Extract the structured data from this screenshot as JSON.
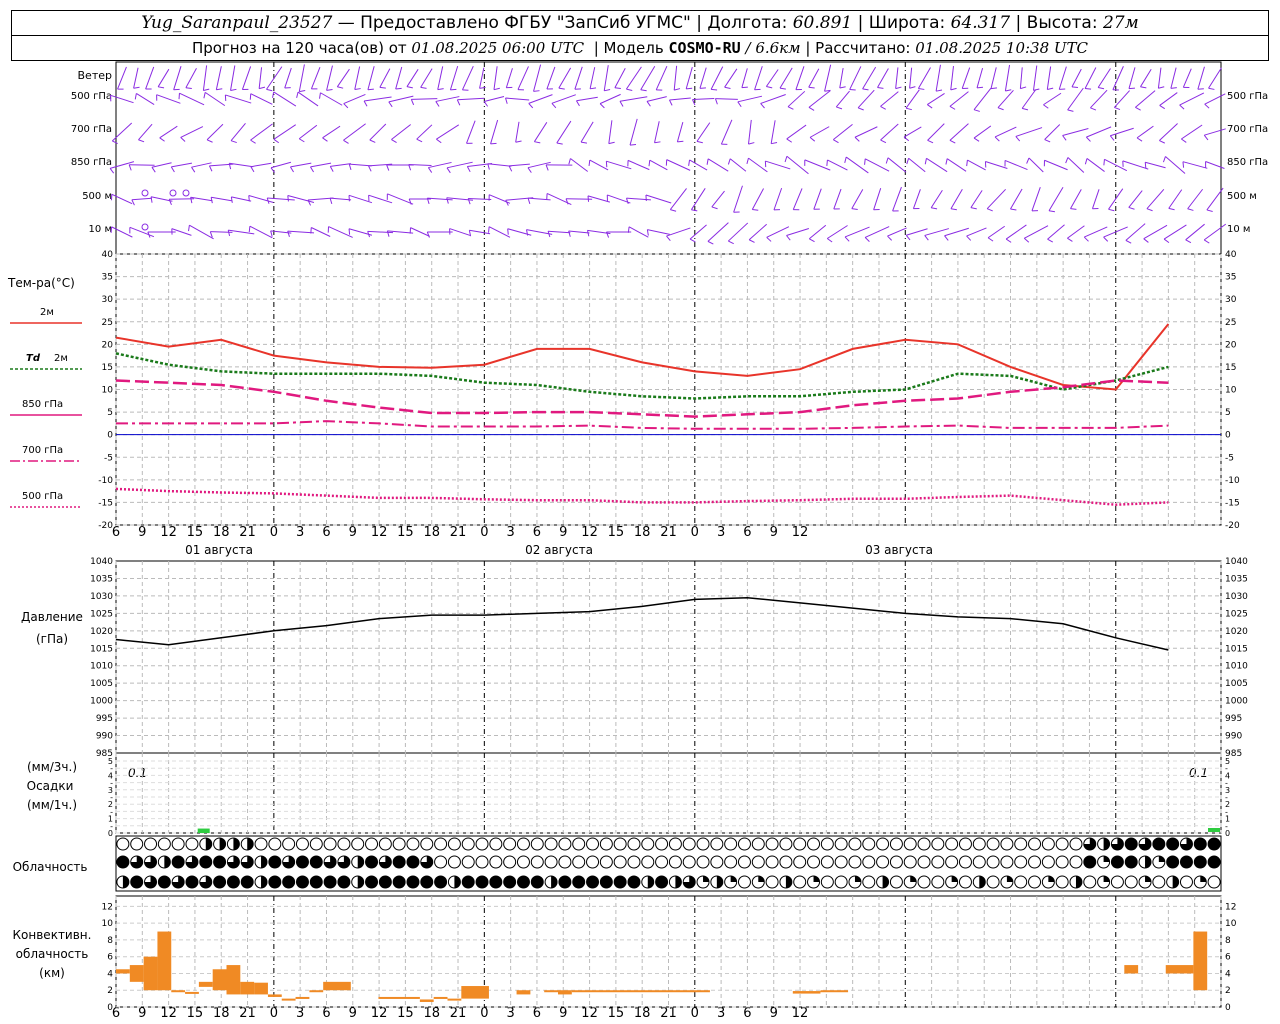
{
  "header": {
    "station": "Yug_Saranpaul_23527",
    "provider": "— Предоставлено ФГБУ \"ЗапСиб УГМС\"",
    "lon_label": "Долгота:",
    "lon": "60.891",
    "lat_label": "Широта:",
    "lat": "64.317",
    "alt_label": "Высота:",
    "alt": "27м",
    "forecast_prefix": "Прогноз на 120 часа(ов) от",
    "forecast_start": "01.08.2025 06:00 UTC",
    "model_label": "Модель",
    "model_name": "COSMO-RU",
    "model_res": "/ 6.6км",
    "calc_label": "Рассчитано:",
    "calc_time": "01.08.2025 10:38 UTC"
  },
  "labels": {
    "wind": "Ветер",
    "wind_levels": [
      "500 гПа",
      "700 гПа",
      "850 гПа",
      "500 м",
      "10  м"
    ],
    "temp": "Тем-ра(°C)",
    "t2m": "2м",
    "td": "Td",
    "td2": "2м",
    "t850": "850 гПа",
    "t700": "700 гПа",
    "t500": "500 гПа",
    "pressure": "Давление",
    "pressure_unit": "(гПа)",
    "precip_unit3": "(мм/3ч.)",
    "precip": "Осадки",
    "precip_unit1": "(мм/1ч.)",
    "precip_left_val": "0.1",
    "precip_right_val": "0.1",
    "cloud": "Облачность",
    "conv1": "Конвективн.",
    "conv2": "облачность",
    "conv3": "(км)"
  },
  "time_axis": {
    "hour_labels": [
      "6",
      "9",
      "12",
      "15",
      "18",
      "21",
      "0",
      "3",
      "6",
      "9",
      "12",
      "15",
      "18",
      "21",
      "0",
      "3",
      "6",
      "9",
      "12",
      "15",
      "18",
      "21",
      "0",
      "3",
      "6",
      "9",
      "12"
    ],
    "date_labels": [
      "01 августа",
      "02 августа",
      "03 августа"
    ]
  },
  "colors": {
    "wind": "#8a2be2",
    "t2m": "#e8342a",
    "td": "#1a7a1a",
    "t850": "#e0197f",
    "t700": "#e0197f",
    "t500": "#e0197f",
    "pressure": "#000000",
    "precip": "#2ecc40",
    "conv": "#f08a24",
    "zero_line": "#0000cc"
  },
  "chart_data": [
    {
      "type": "line",
      "title": "Тем-ра(°C)",
      "x_unit": "hours from 01.08.2025 06:00 UTC",
      "ylim": [
        -20,
        40
      ],
      "yticks": [
        -20,
        -15,
        -10,
        -5,
        0,
        5,
        10,
        15,
        20,
        25,
        30,
        35,
        40
      ],
      "grid": true,
      "x": [
        0,
        6,
        12,
        18,
        24,
        30,
        36,
        42,
        48,
        54,
        60,
        66,
        72,
        78,
        84,
        90,
        96,
        102,
        108,
        114,
        120
      ],
      "series": [
        {
          "name": "2м",
          "values": [
            21.5,
            19.5,
            21,
            17.5,
            16,
            15,
            14.8,
            15.5,
            19,
            19,
            16,
            14,
            13,
            14.5,
            19,
            21,
            20,
            15,
            11,
            10,
            24.5
          ]
        },
        {
          "name": "Td 2м",
          "values": [
            18,
            15.5,
            14,
            13.5,
            13.5,
            13.5,
            13,
            11.5,
            11,
            9.5,
            8.5,
            8,
            8.5,
            8.5,
            9.5,
            10,
            13.5,
            13,
            10,
            12,
            15
          ]
        },
        {
          "name": "850 гПа",
          "values": [
            12,
            11.5,
            11,
            9.5,
            7.5,
            6,
            4.8,
            4.8,
            5,
            5,
            4.5,
            4,
            4.5,
            5,
            6.5,
            7.5,
            8,
            9.5,
            10.5,
            12,
            11.5
          ]
        },
        {
          "name": "700 гПа",
          "values": [
            2.5,
            2.5,
            2.5,
            2.5,
            3,
            2.5,
            1.8,
            1.8,
            1.8,
            2,
            1.5,
            1.3,
            1.3,
            1.3,
            1.5,
            1.8,
            2,
            1.5,
            1.5,
            1.5,
            2
          ]
        },
        {
          "name": "500 гПа",
          "values": [
            -12,
            -12.5,
            -12.8,
            -13,
            -13.5,
            -14,
            -14,
            -14.3,
            -14.5,
            -14.5,
            -15,
            -15,
            -14.7,
            -14.5,
            -14.2,
            -14.2,
            -13.8,
            -13.5,
            -14.5,
            -15.5,
            -15
          ]
        }
      ]
    },
    {
      "type": "line",
      "title": "Давление (гПа)",
      "x_unit": "hours from 01.08.2025 06:00 UTC",
      "ylim": [
        985,
        1040
      ],
      "yticks": [
        985,
        990,
        995,
        1000,
        1005,
        1010,
        1015,
        1020,
        1025,
        1030,
        1035,
        1040
      ],
      "grid": true,
      "x": [
        0,
        6,
        12,
        18,
        24,
        30,
        36,
        42,
        48,
        54,
        60,
        66,
        72,
        78,
        84,
        90,
        96,
        102,
        108,
        114,
        120
      ],
      "series": [
        {
          "name": "Давление",
          "values": [
            1017.5,
            1016,
            1018,
            1020,
            1021.5,
            1023.5,
            1024.5,
            1024.5,
            1025,
            1025.5,
            1027,
            1029,
            1029.5,
            1028,
            1026.5,
            1025,
            1024,
            1023.5,
            1022,
            1018,
            1014.5
          ]
        }
      ]
    },
    {
      "type": "bar",
      "title": "Осадки",
      "ylim": [
        0,
        5
      ],
      "x": [
        10
      ],
      "values": [
        0.1
      ]
    },
    {
      "type": "bar",
      "title": "Конвективн. облачность (км)",
      "ylim": [
        0,
        13
      ],
      "yticks": [
        0,
        2,
        4,
        6,
        8,
        10,
        12
      ],
      "segments": [
        {
          "x0": 0,
          "x1": 1,
          "base": 4,
          "top": 4.5
        },
        {
          "x0": 1,
          "x1": 2,
          "base": 3,
          "top": 5
        },
        {
          "x0": 2,
          "x1": 3,
          "base": 2,
          "top": 6
        },
        {
          "x0": 3,
          "x1": 4,
          "base": 2,
          "top": 9
        },
        {
          "x0": 4,
          "x1": 5,
          "base": 1.8,
          "top": 2
        },
        {
          "x0": 5,
          "x1": 6,
          "base": 1.6,
          "top": 1.8
        },
        {
          "x0": 6,
          "x1": 7,
          "base": 2.4,
          "top": 3
        },
        {
          "x0": 7,
          "x1": 8,
          "base": 2,
          "top": 4.5
        },
        {
          "x0": 8,
          "x1": 9,
          "base": 1.5,
          "top": 5
        },
        {
          "x0": 9,
          "x1": 10,
          "base": 1.5,
          "top": 3
        },
        {
          "x0": 10,
          "x1": 11,
          "base": 1.5,
          "top": 2.9
        },
        {
          "x0": 11,
          "x1": 12,
          "base": 1.2,
          "top": 1.5
        },
        {
          "x0": 12,
          "x1": 13,
          "base": 0.8,
          "top": 1
        },
        {
          "x0": 13,
          "x1": 14,
          "base": 1,
          "top": 1.2
        },
        {
          "x0": 14,
          "x1": 15,
          "base": 1.8,
          "top": 2
        },
        {
          "x0": 15,
          "x1": 17,
          "base": 2,
          "top": 3
        },
        {
          "x0": 19,
          "x1": 22,
          "base": 1,
          "top": 1.2
        },
        {
          "x0": 22,
          "x1": 23,
          "base": 0.6,
          "top": 0.9
        },
        {
          "x0": 23,
          "x1": 24,
          "base": 1,
          "top": 1.2
        },
        {
          "x0": 24,
          "x1": 25,
          "base": 0.8,
          "top": 1
        },
        {
          "x0": 25,
          "x1": 27,
          "base": 1,
          "top": 2.5
        },
        {
          "x0": 29,
          "x1": 30,
          "base": 1.5,
          "top": 2
        },
        {
          "x0": 31,
          "x1": 32,
          "base": 1.8,
          "top": 2
        },
        {
          "x0": 32,
          "x1": 33,
          "base": 1.5,
          "top": 2
        },
        {
          "x0": 33,
          "x1": 43,
          "base": 1.8,
          "top": 2
        },
        {
          "x0": 49,
          "x1": 51,
          "base": 1.6,
          "top": 1.9
        },
        {
          "x0": 51,
          "x1": 53,
          "base": 1.8,
          "top": 2
        },
        {
          "x0": 73,
          "x1": 74,
          "base": 4,
          "top": 5
        },
        {
          "x0": 76,
          "x1": 78,
          "base": 4,
          "top": 5
        },
        {
          "x0": 78,
          "x1": 79,
          "base": 2,
          "top": 9
        }
      ]
    }
  ]
}
